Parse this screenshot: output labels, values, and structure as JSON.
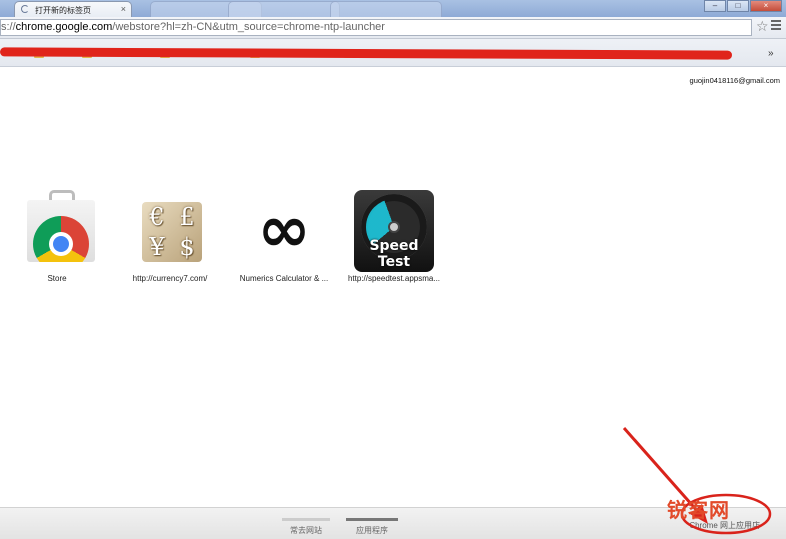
{
  "tab": {
    "title": "打开新的标签页",
    "close": "×"
  },
  "window": {
    "minimize": "–",
    "maximize": "□",
    "close": "×"
  },
  "omnibox": {
    "prefix": "s://",
    "host": "chrome.google.com",
    "path": "/webstore?hl=zh-CN&utm_source=chrome-ntp-launcher"
  },
  "bookmarks": {
    "overflow": "»"
  },
  "account": {
    "email": "guojin0418116@gmail.com"
  },
  "apps": [
    {
      "label": "Store",
      "icon": "chrome-store-icon"
    },
    {
      "label": "http://currency7.com/",
      "icon": "currency-icon",
      "glyphs": [
        "€",
        "£",
        "¥",
        "$"
      ]
    },
    {
      "label": "Numerics Calculator & ...",
      "icon": "infinity-icon",
      "glyph": "∞"
    },
    {
      "label": "http://speedtest.appsma...",
      "icon": "speedtest-icon",
      "badge": "Speed Test"
    }
  ],
  "bottom": {
    "tabs": [
      {
        "label": "常去网站",
        "active": false
      },
      {
        "label": "应用程序",
        "active": true
      }
    ],
    "store_link": "Chrome 网上应用店"
  },
  "watermark": {
    "text": "锐客网"
  },
  "colors": {
    "accent_red": "#e0241b",
    "tab_active_bar": "#777777",
    "tab_inactive_bar": "#cccccc"
  }
}
